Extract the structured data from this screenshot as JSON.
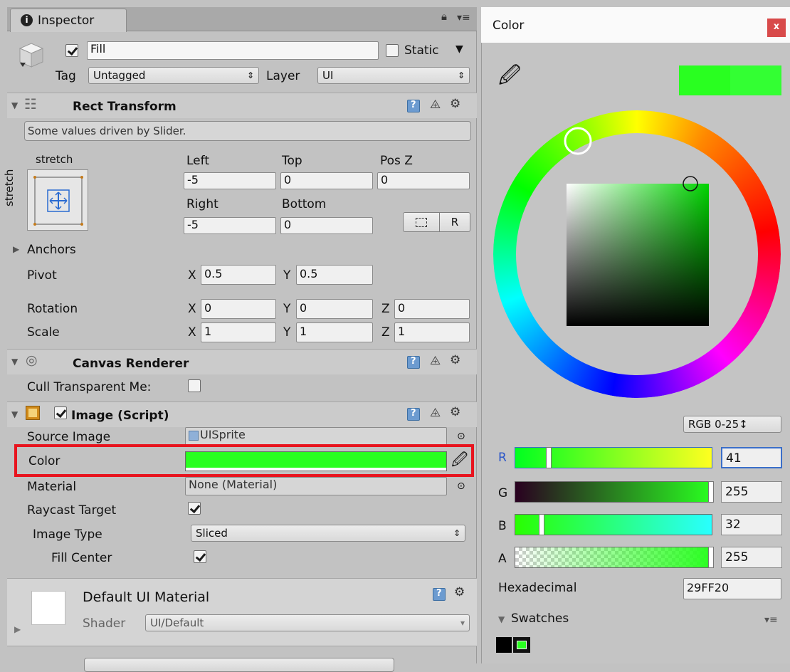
{
  "inspector": {
    "tab_label": "Inspector",
    "object": {
      "name": "Fill",
      "active": true,
      "static_label": "Static",
      "static_checked": false,
      "tag_label": "Tag",
      "tag_value": "Untagged",
      "layer_label": "Layer",
      "layer_value": "UI"
    },
    "rect_transform": {
      "title": "Rect Transform",
      "note": "Some values driven by Slider.",
      "stretch_h": "stretch",
      "stretch_v": "stretch",
      "left_label": "Left",
      "left_value": "-5",
      "top_label": "Top",
      "top_value": "0",
      "posz_label": "Pos Z",
      "posz_value": "0",
      "right_label": "Right",
      "right_value": "-5",
      "bottom_label": "Bottom",
      "bottom_value": "0",
      "raw_button": "R",
      "anchors_label": "Anchors",
      "pivot_label": "Pivot",
      "pivot_x": "0.5",
      "pivot_y": "0.5",
      "rotation_label": "Rotation",
      "rot_x": "0",
      "rot_y": "0",
      "rot_z": "0",
      "scale_label": "Scale",
      "scale_x": "1",
      "scale_y": "1",
      "scale_z": "1",
      "x": "X",
      "y": "Y",
      "z": "Z"
    },
    "canvas_renderer": {
      "title": "Canvas Renderer",
      "cull_label": "Cull Transparent Me:",
      "cull_checked": false
    },
    "image": {
      "title": "Image (Script)",
      "enabled": true,
      "source_label": "Source Image",
      "source_value": "UISprite",
      "color_label": "Color",
      "color_hex": "#29FF20",
      "material_label": "Material",
      "material_value": "None (Material)",
      "raycast_label": "Raycast Target",
      "raycast_checked": true,
      "type_label": "Image Type",
      "type_value": "Sliced",
      "fill_center_label": "Fill Center",
      "fill_center_checked": true
    },
    "material": {
      "title": "Default UI Material",
      "shader_label": "Shader",
      "shader_value": "UI/Default"
    }
  },
  "color_window": {
    "title": "Color",
    "close_label": "x",
    "mode_value": "RGB 0-25↕",
    "channels": [
      {
        "label": "R",
        "value": "41"
      },
      {
        "label": "G",
        "value": "255"
      },
      {
        "label": "B",
        "value": "32"
      },
      {
        "label": "A",
        "value": "255"
      }
    ],
    "hex_label": "Hexadecimal",
    "hex_value": "29FF20",
    "swatches_label": "Swatches"
  },
  "colors": {
    "current": "#29FF20",
    "highlight": "#e8141e",
    "selection_blue": "#3a6ec9"
  }
}
